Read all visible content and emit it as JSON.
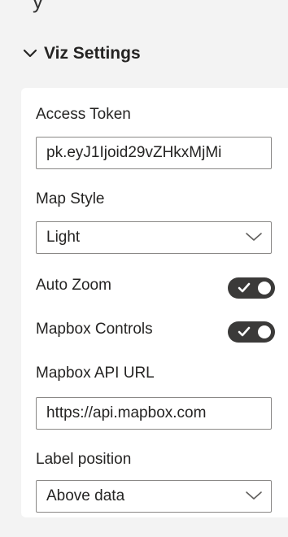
{
  "section": {
    "title": "Viz Settings",
    "icon": "chevron-down-icon"
  },
  "access_token": {
    "label": "Access Token",
    "value": "pk.eyJ1Ijoid29vZHkxMjMi"
  },
  "map_style": {
    "label": "Map Style",
    "selected": "Light"
  },
  "auto_zoom": {
    "label": "Auto Zoom",
    "state": "on"
  },
  "mapbox_controls": {
    "label": "Mapbox Controls",
    "state": "on"
  },
  "mapbox_api_url": {
    "label": "Mapbox API URL",
    "value": "https://api.mapbox.com"
  },
  "label_position": {
    "label": "Label position",
    "selected": "Above data"
  },
  "colors": {
    "background": "#f3f3f3",
    "panel": "#ffffff",
    "toggle_on": "#3b3a39",
    "border": "#8a8886"
  }
}
